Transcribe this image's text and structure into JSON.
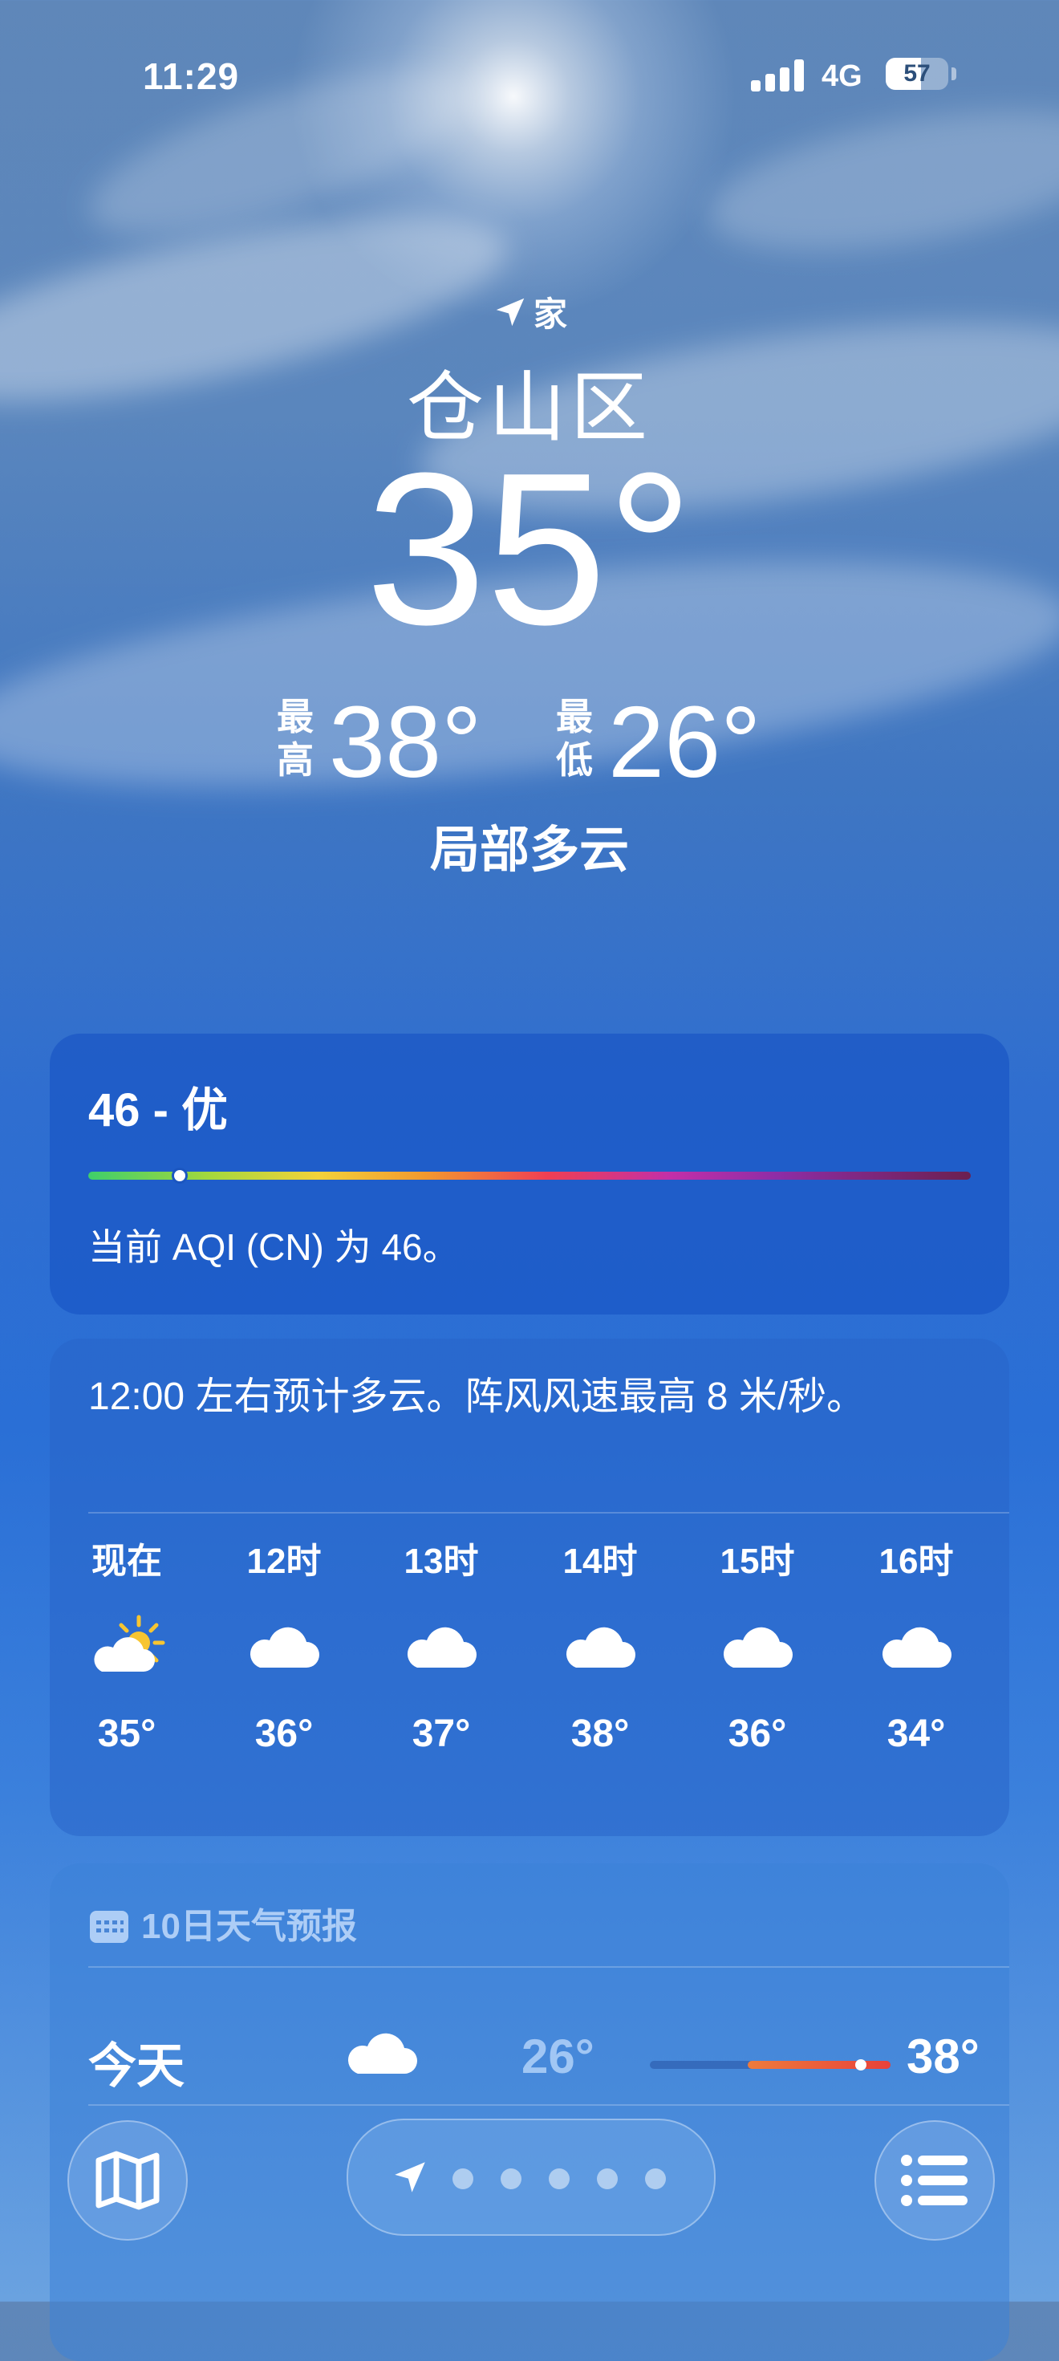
{
  "status_bar": {
    "time": "11:29",
    "network": "4G",
    "battery": "57"
  },
  "header": {
    "location_label": "家",
    "city": "仓山区",
    "temperature": "35°",
    "high_label": "最高",
    "high_value": "38°",
    "low_label": "最低",
    "low_value": "26°",
    "condition": "局部多云"
  },
  "aqi": {
    "title": "46 - 优",
    "description": "当前 AQI (CN) 为 46。",
    "level": 46
  },
  "hourly": {
    "summary": "12:00 左右预计多云。阵风风速最高 8 米/秒。",
    "items": [
      {
        "time": "现在",
        "icon": "partly-sunny-icon",
        "temp": "35°"
      },
      {
        "time": "12时",
        "icon": "cloud-icon",
        "temp": "36°"
      },
      {
        "time": "13时",
        "icon": "cloud-icon",
        "temp": "37°"
      },
      {
        "time": "14时",
        "icon": "cloud-icon",
        "temp": "38°"
      },
      {
        "time": "15时",
        "icon": "cloud-icon",
        "temp": "36°"
      },
      {
        "time": "16时",
        "icon": "cloud-icon",
        "temp": "34°"
      }
    ]
  },
  "forecast": {
    "title": "10日天气预报",
    "today": {
      "day": "今天",
      "icon": "cloud-icon",
      "low": "26°",
      "high": "38°"
    }
  },
  "bottom_bar": {
    "page_count": 5
  },
  "colors": {
    "accent_orange": "#ee7b3c",
    "accent_red": "#e8413a",
    "card_blue": "#245cbe"
  }
}
